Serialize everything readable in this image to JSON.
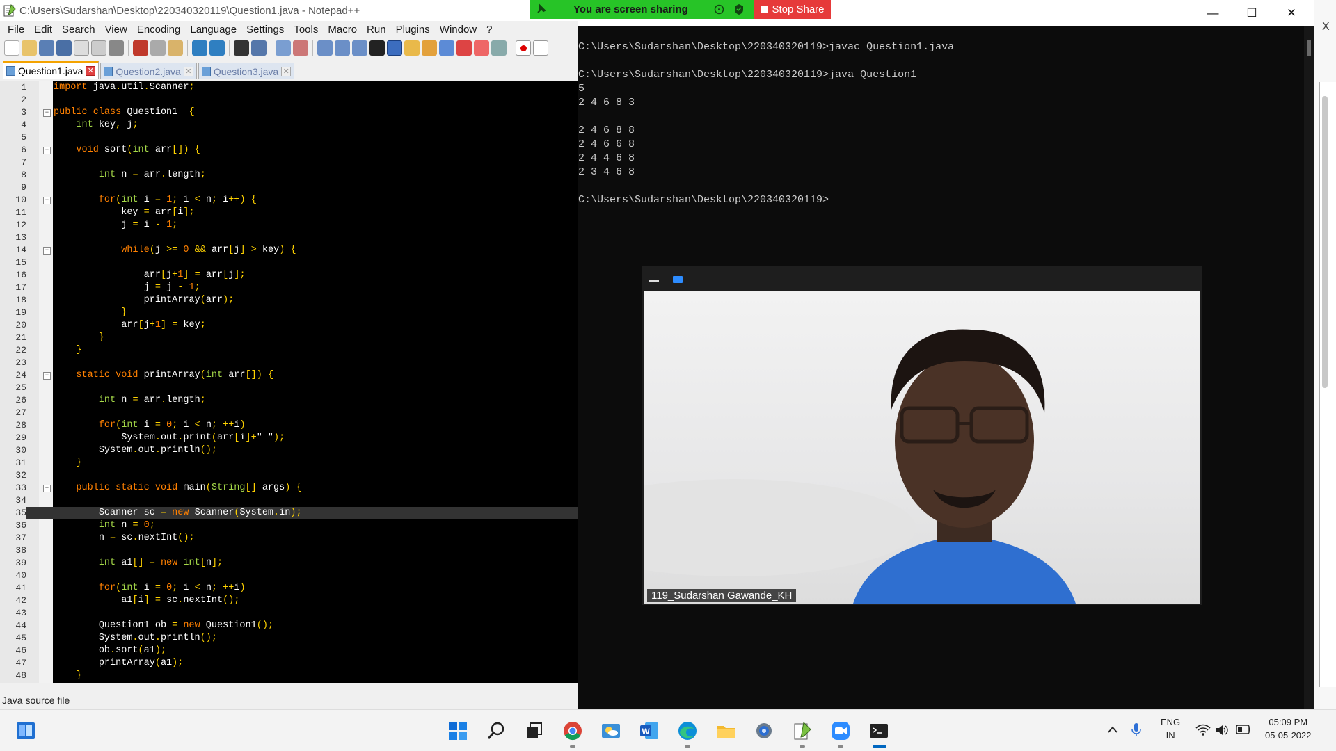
{
  "notepad": {
    "title": "C:\\Users\\Sudarshan\\Desktop\\220340320119\\Question1.java - Notepad++",
    "menu": [
      "File",
      "Edit",
      "Search",
      "View",
      "Encoding",
      "Language",
      "Settings",
      "Tools",
      "Macro",
      "Run",
      "Plugins",
      "Window",
      "?"
    ],
    "tabs": [
      {
        "label": "Question1.java",
        "active": true
      },
      {
        "label": "Question2.java",
        "active": false
      },
      {
        "label": "Question3.java",
        "active": false
      }
    ],
    "status": "Java source file",
    "highlighted_line": 35,
    "code": [
      "import java.util.Scanner;",
      "",
      "public class Question1  {",
      "    int key, j;",
      "",
      "    void sort(int arr[]) {",
      "",
      "        int n = arr.length;",
      "",
      "        for(int i = 1; i < n; i++) {",
      "            key = arr[i];",
      "            j = i - 1;",
      "",
      "            while(j >= 0 && arr[j] > key) {",
      "",
      "                arr[j+1] = arr[j];",
      "                j = j - 1;",
      "                printArray(arr);",
      "            }",
      "            arr[j+1] = key;",
      "        }",
      "    }",
      "",
      "    static void printArray(int arr[]) {",
      "",
      "        int n = arr.length;",
      "",
      "        for(int i = 0; i < n; ++i)",
      "            System.out.print(arr[i]+\" \");",
      "        System.out.println();",
      "    }",
      "",
      "    public static void main(String[] args) {",
      "",
      "        Scanner sc = new Scanner(System.in);",
      "        int n = 0;",
      "        n = sc.nextInt();",
      "",
      "        int a1[] = new int[n];",
      "",
      "        for(int i = 0; i < n; ++i)",
      "            a1[i] = sc.nextInt();",
      "",
      "        Question1 ob = new Question1();",
      "        System.out.println();",
      "        ob.sort(a1);",
      "        printArray(a1);",
      "    }"
    ],
    "fold_lines": [
      3,
      6,
      10,
      14,
      24,
      33
    ]
  },
  "console": {
    "lines": [
      "C:\\Users\\Sudarshan\\Desktop\\220340320119>javac Question1.java",
      "",
      "C:\\Users\\Sudarshan\\Desktop\\220340320119>java Question1",
      "5",
      "2 4 6 8 3",
      "",
      "2 4 6 8 8",
      "2 4 6 6 8",
      "2 4 4 6 8",
      "2 3 4 6 8",
      "",
      "C:\\Users\\Sudarshan\\Desktop\\220340320119>"
    ]
  },
  "share": {
    "status": "You are screen sharing",
    "stop_label": "Stop Share"
  },
  "video": {
    "participant": "119_Sudarshan Gawande_KH"
  },
  "behind_window": {
    "close_glyph": "X"
  },
  "taskbar": {
    "icons": [
      "start-icon",
      "search-icon",
      "task-view-icon",
      "chrome-icon",
      "weather-icon",
      "word-icon",
      "edge-icon",
      "file-explorer-icon",
      "settings-icon",
      "notepad-plus-plus-icon",
      "zoom-icon",
      "terminal-icon"
    ],
    "lang_line1": "ENG",
    "lang_line2": "IN",
    "time": "05:09 PM",
    "date": "05-05-2022"
  },
  "colors": {
    "editor_bg": "#000000",
    "keyword": "#ff8000",
    "type": "#a5d848",
    "operator": "#ffd200",
    "share_green": "#27c427",
    "stop_red": "#e63a3a"
  }
}
